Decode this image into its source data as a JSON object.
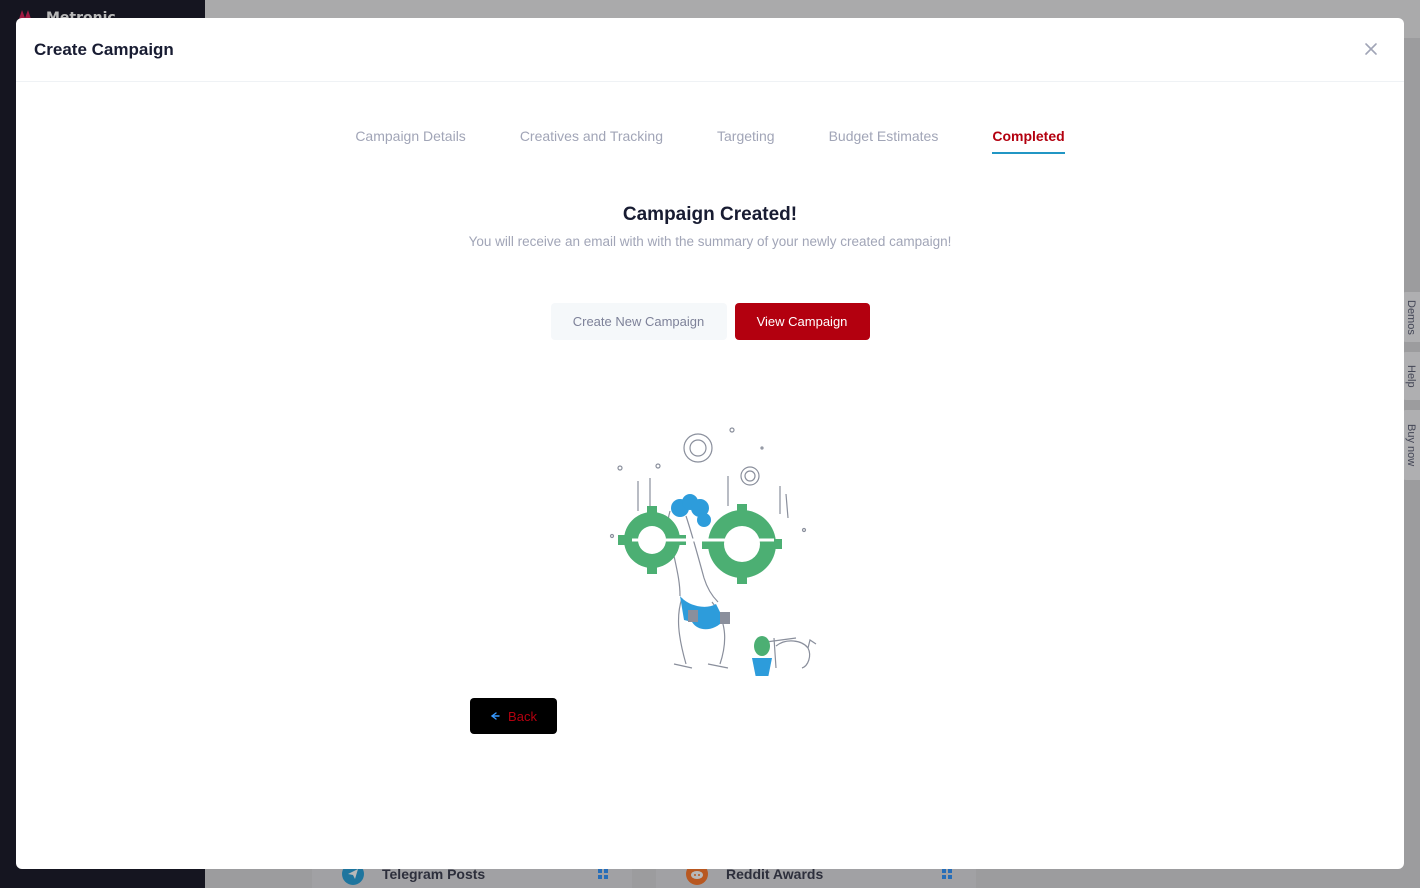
{
  "modal": {
    "title": "Create Campaign",
    "close_icon": "close-icon"
  },
  "stepper": {
    "steps": [
      {
        "label": "Campaign Details",
        "active": false
      },
      {
        "label": "Creatives and Tracking",
        "active": false
      },
      {
        "label": "Targeting",
        "active": false
      },
      {
        "label": "Budget Estimates",
        "active": false
      },
      {
        "label": "Completed",
        "active": true
      }
    ]
  },
  "completed": {
    "headline": "Campaign Created!",
    "message": "You will receive an email with with the summary of your newly created campaign!",
    "create_new_label": "Create New Campaign",
    "view_label": "View Campaign",
    "illustration": "person-lifting-gears-illustration"
  },
  "back_button": {
    "label": "Back",
    "icon": "arrow-left-icon"
  },
  "background": {
    "logo_text": "Metronic",
    "cards": [
      {
        "label": "Telegram Posts",
        "icon": "telegram-icon"
      },
      {
        "label": "Reddit Awards",
        "icon": "reddit-icon"
      }
    ],
    "side_tabs": [
      "Demos",
      "Help",
      "Buy now"
    ]
  },
  "colors": {
    "accent": "#b3000f",
    "step_underline": "#2196c4",
    "muted": "#a1a5b7"
  }
}
